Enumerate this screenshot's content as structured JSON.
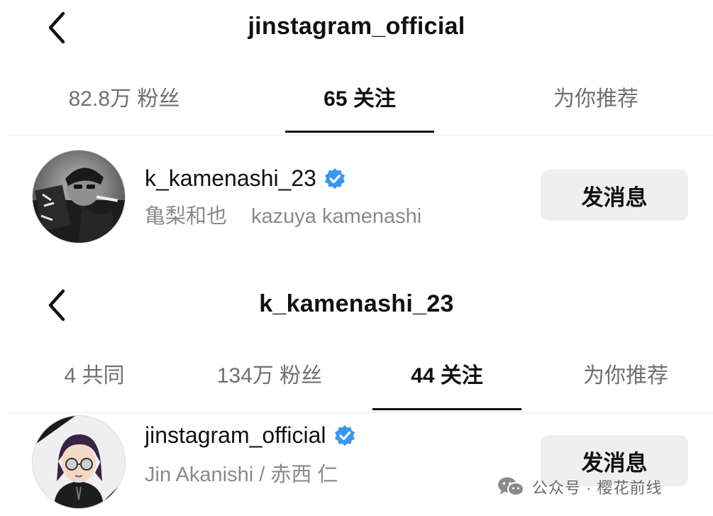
{
  "top_panel": {
    "title": "jinstagram_official",
    "tabs": [
      {
        "label": "82.8万 粉丝",
        "active": false
      },
      {
        "label": "65 关注",
        "active": true
      },
      {
        "label": "为你推荐",
        "active": false
      }
    ],
    "user": {
      "username": "k_kamenashi_23",
      "verified": true,
      "full_name_jp": "亀梨和也",
      "full_name_en": "kazuya kamenashi",
      "message_button": "发消息"
    }
  },
  "bottom_panel": {
    "title": "k_kamenashi_23",
    "tabs": [
      {
        "label": "4 共同",
        "active": false
      },
      {
        "label": "134万 粉丝",
        "active": false
      },
      {
        "label": "44 关注",
        "active": true
      },
      {
        "label": "为你推荐",
        "active": false
      }
    ],
    "user": {
      "username": "jinstagram_official",
      "verified": true,
      "full_name": "Jin Akanishi / 赤西 仁",
      "message_button": "发消息"
    }
  },
  "watermark": "公众号 · 樱花前线",
  "colors": {
    "verified_badge": "#3897f0",
    "tab_inactive": "#6f6f6f",
    "tab_active": "#111111",
    "button_bg": "#efefef",
    "secondary_text": "#8a8a8a"
  },
  "icons": {
    "back": "chevron-left-icon",
    "verified": "verified-badge-icon",
    "watermark": "wechat-icon"
  }
}
